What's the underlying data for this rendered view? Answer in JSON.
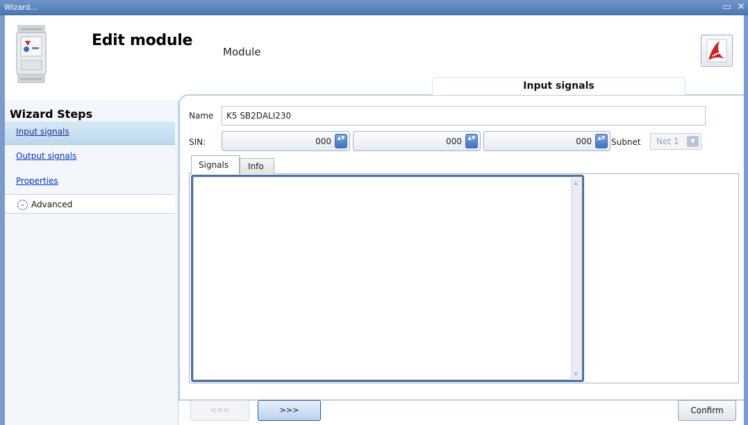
{
  "window": {
    "title": "Wizard...",
    "maximize_glyph": "▭",
    "close_glyph": "✕"
  },
  "header": {
    "title": "Edit module",
    "subtitle": "Module",
    "pdf_icon": "pdf-icon"
  },
  "colors": {
    "titlebar": "#5a82ba",
    "accent_blue": "#3d72c0",
    "link": "#0033cc",
    "panel_border": "#b8cde6"
  },
  "sidebar": {
    "title": "Wizard Steps",
    "items": [
      {
        "label": "Input signals",
        "active": true
      },
      {
        "label": "Output signals",
        "active": false
      },
      {
        "label": "Properties",
        "active": false
      }
    ],
    "advanced_label": "Advanced",
    "advanced_glyph": "⌄"
  },
  "main": {
    "section_tab": "Input signals",
    "name_label": "Name",
    "name_value": "K5 SB2DALI230",
    "sin_label": "SIN:",
    "sin_values": [
      "000",
      "000",
      "000"
    ],
    "spin_glyph": "▲▼",
    "subnet_label": "Subnet",
    "subnet_value": "Net 1",
    "subnet_glyph": "▼",
    "tabs": [
      {
        "label": "Signals",
        "selected": true
      },
      {
        "label": "Info",
        "selected": false
      }
    ],
    "scroll_up": "▲",
    "scroll_down": "▼"
  },
  "footer": {
    "back_label": "<<<",
    "next_label": ">>>",
    "confirm_label": "Confirm"
  }
}
